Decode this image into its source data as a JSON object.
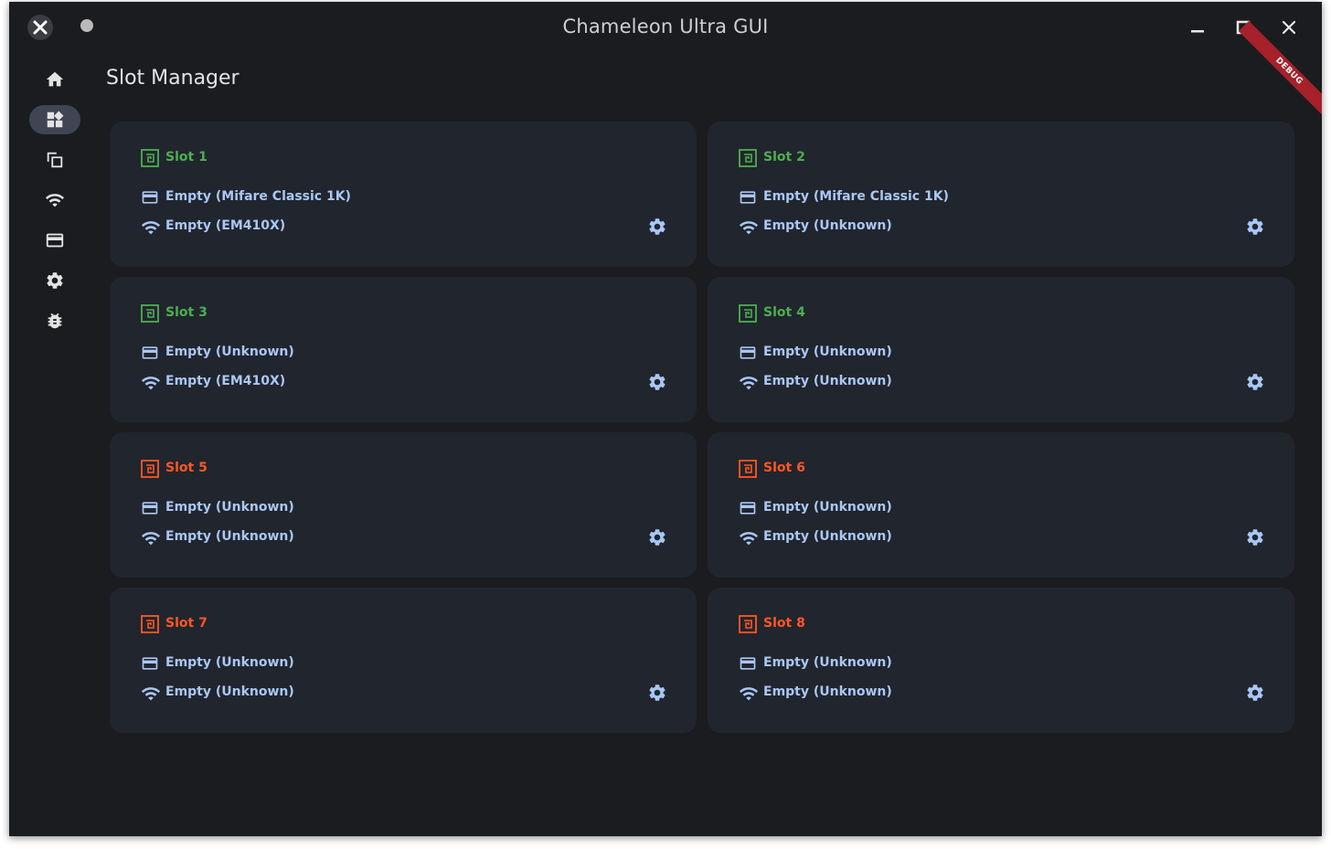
{
  "window": {
    "title": "Chameleon Ultra GUI",
    "debug_label": "DEBUG",
    "controls": [
      "minimize-icon",
      "maximize-icon",
      "close-icon"
    ]
  },
  "sidebar": {
    "items": [
      {
        "icon": "home-icon",
        "active": false
      },
      {
        "icon": "dashboard-icon",
        "active": true
      },
      {
        "icon": "copy-icon",
        "active": false
      },
      {
        "icon": "wifi-icon",
        "active": false
      },
      {
        "icon": "card-icon",
        "active": false
      },
      {
        "icon": "gear-icon",
        "active": false
      },
      {
        "icon": "bug-icon",
        "active": false
      }
    ]
  },
  "page": {
    "title": "Slot Manager"
  },
  "colors": {
    "enabled": "#4caf50",
    "disabled": "#ff5722",
    "text_accent": "#a9c7f5",
    "card_bg": "#21252d",
    "window_bg": "#1a1c20"
  },
  "slots": [
    {
      "name": "Slot 1",
      "status": "enabled",
      "hf": "Empty (Mifare Classic 1K)",
      "lf": "Empty (EM410X)"
    },
    {
      "name": "Slot 2",
      "status": "enabled",
      "hf": "Empty (Mifare Classic 1K)",
      "lf": "Empty (Unknown)"
    },
    {
      "name": "Slot 3",
      "status": "enabled",
      "hf": "Empty (Unknown)",
      "lf": "Empty (EM410X)"
    },
    {
      "name": "Slot 4",
      "status": "enabled",
      "hf": "Empty (Unknown)",
      "lf": "Empty (Unknown)"
    },
    {
      "name": "Slot 5",
      "status": "disabled",
      "hf": "Empty (Unknown)",
      "lf": "Empty (Unknown)"
    },
    {
      "name": "Slot 6",
      "status": "disabled",
      "hf": "Empty (Unknown)",
      "lf": "Empty (Unknown)"
    },
    {
      "name": "Slot 7",
      "status": "disabled",
      "hf": "Empty (Unknown)",
      "lf": "Empty (Unknown)"
    },
    {
      "name": "Slot 8",
      "status": "disabled",
      "hf": "Empty (Unknown)",
      "lf": "Empty (Unknown)"
    }
  ]
}
